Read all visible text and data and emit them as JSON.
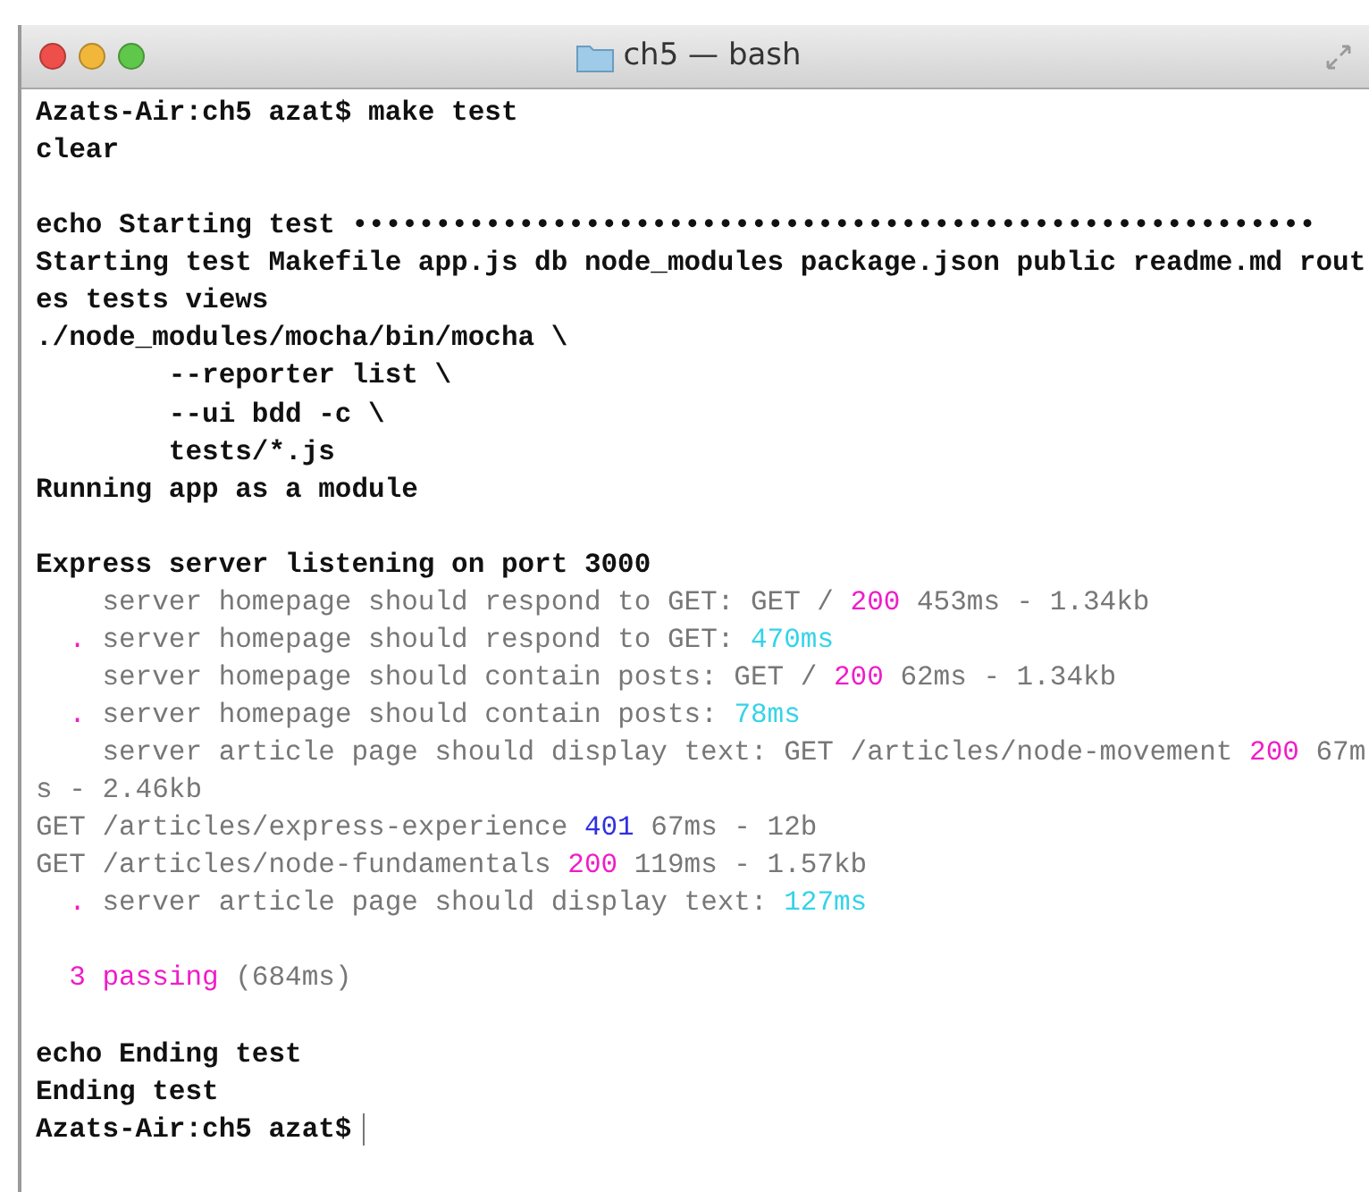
{
  "window": {
    "title": "ch5 — bash"
  },
  "terminal": {
    "blocks": [
      [
        [
          {
            "text": "Azats-Air:ch5 azat$ make test",
            "kind": "bold"
          }
        ],
        [
          {
            "text": "clear",
            "kind": "bold"
          }
        ]
      ],
      [
        [
          {
            "text": "echo Starting test ••••••••••••••••••••••••••••••••••••••••••••••••••••••••••",
            "kind": "bold"
          }
        ],
        [
          {
            "text": "Starting test Makefile app.js db node_modules package.json public readme.md rout",
            "kind": "bold"
          }
        ],
        [
          {
            "text": "es tests views",
            "kind": "bold"
          }
        ],
        [
          {
            "text": "./node_modules/mocha/bin/mocha \\",
            "kind": "bold"
          }
        ],
        [
          {
            "text": "        --reporter list \\",
            "kind": "bold"
          }
        ],
        [
          {
            "text": "        --ui bdd -c \\",
            "kind": "bold"
          }
        ],
        [
          {
            "text": "        tests/*.js",
            "kind": "bold"
          }
        ],
        [
          {
            "text": "Running app as a module",
            "kind": "bold"
          }
        ]
      ],
      [
        [
          {
            "text": "Express server listening on port 3000",
            "kind": "bold"
          }
        ],
        [
          {
            "text": "    server homepage should respond to GET: GET / ",
            "kind": "dim"
          },
          {
            "text": "200",
            "kind": "magenta"
          },
          {
            "text": " 453ms - 1.34kb",
            "kind": "dim"
          }
        ],
        [
          {
            "text": "  . ",
            "kind": "magenta"
          },
          {
            "text": "server homepage should respond to GET: ",
            "kind": "dim"
          },
          {
            "text": "470ms",
            "kind": "cyan"
          }
        ],
        [
          {
            "text": "    server homepage should contain posts: GET / ",
            "kind": "dim"
          },
          {
            "text": "200",
            "kind": "magenta"
          },
          {
            "text": " 62ms - 1.34kb",
            "kind": "dim"
          }
        ],
        [
          {
            "text": "  . ",
            "kind": "magenta"
          },
          {
            "text": "server homepage should contain posts: ",
            "kind": "dim"
          },
          {
            "text": "78ms",
            "kind": "cyan"
          }
        ],
        [
          {
            "text": "    server article page should display text: GET /articles/node-movement ",
            "kind": "dim"
          },
          {
            "text": "200",
            "kind": "magenta"
          },
          {
            "text": " 67m",
            "kind": "dim"
          }
        ],
        [
          {
            "text": "s - 2.46kb",
            "kind": "dim"
          }
        ],
        [
          {
            "text": "GET /articles/express-experience ",
            "kind": "dim"
          },
          {
            "text": "401",
            "kind": "blue"
          },
          {
            "text": " 67ms - 12b",
            "kind": "dim"
          }
        ],
        [
          {
            "text": "GET /articles/node-fundamentals ",
            "kind": "dim"
          },
          {
            "text": "200",
            "kind": "magenta"
          },
          {
            "text": " 119ms - 1.57kb",
            "kind": "dim"
          }
        ],
        [
          {
            "text": "  . ",
            "kind": "magenta"
          },
          {
            "text": "server article page should display text: ",
            "kind": "dim"
          },
          {
            "text": "127ms",
            "kind": "cyan"
          }
        ]
      ],
      [
        [
          {
            "text": "  3 passing",
            "kind": "magenta"
          },
          {
            "text": " (684ms)",
            "kind": "dim"
          }
        ]
      ],
      [
        [
          {
            "text": "echo Ending test",
            "kind": "bold"
          }
        ],
        [
          {
            "text": "Ending test",
            "kind": "bold"
          }
        ],
        [
          {
            "text": "Azats-Air:ch5 azat$",
            "kind": "bold"
          }
        ]
      ]
    ],
    "cursor": true
  }
}
